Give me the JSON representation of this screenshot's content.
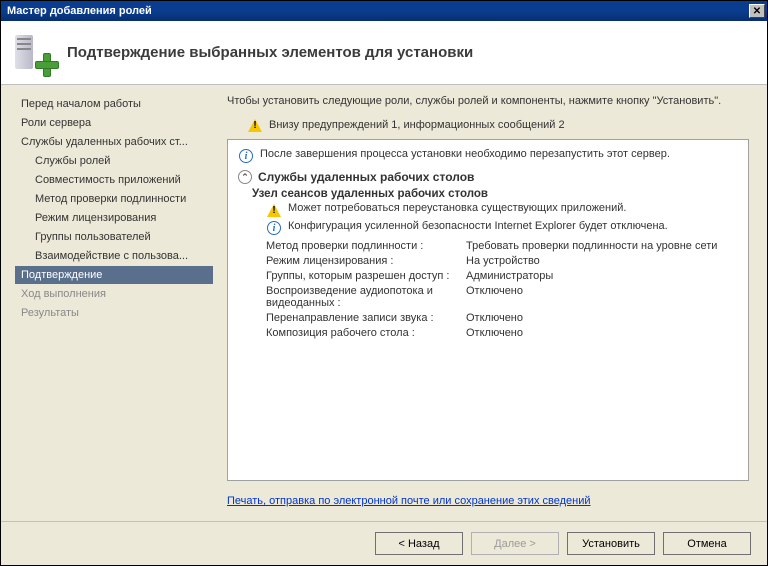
{
  "window": {
    "title": "Мастер добавления ролей"
  },
  "header": {
    "title": "Подтверждение выбранных элементов для установки"
  },
  "sidebar": {
    "items": [
      {
        "label": "Перед началом работы",
        "level": 0
      },
      {
        "label": "Роли сервера",
        "level": 0
      },
      {
        "label": "Службы удаленных рабочих ст...",
        "level": 0
      },
      {
        "label": "Службы ролей",
        "level": 1
      },
      {
        "label": "Совместимость приложений",
        "level": 1
      },
      {
        "label": "Метод проверки подлинности",
        "level": 1
      },
      {
        "label": "Режим лицензирования",
        "level": 1
      },
      {
        "label": "Группы пользователей",
        "level": 1
      },
      {
        "label": "Взаимодействие с пользова...",
        "level": 1
      },
      {
        "label": "Подтверждение",
        "level": 0,
        "selected": true
      },
      {
        "label": "Ход выполнения",
        "level": 0,
        "disabled": true
      },
      {
        "label": "Результаты",
        "level": 0,
        "disabled": true
      }
    ]
  },
  "main": {
    "intro": "Чтобы установить следующие роли, службы ролей и компоненты, нажмите кнопку \"Установить\".",
    "summary": "Внизу предупреждений 1, информационных сообщений 2",
    "restart_info": "После завершения процесса установки необходимо перезапустить этот сервер.",
    "role_name": "Службы удаленных рабочих столов",
    "subrole_name": "Узел сеансов удаленных рабочих столов",
    "warnings": [
      "Может потребоваться переустановка существующих приложений.",
      "Конфигурация усиленной безопасности Internet Explorer будет отключена."
    ],
    "kv": [
      {
        "k": "Метод проверки подлинности :",
        "v": "Требовать проверки подлинности на уровне сети"
      },
      {
        "k": "Режим лицензирования :",
        "v": "На устройство"
      },
      {
        "k": "Группы, которым разрешен доступ :",
        "v": "Администраторы"
      },
      {
        "k": "Воспроизведение аудиопотока и видеоданных :",
        "v": "Отключено"
      },
      {
        "k": "Перенаправление записи звука :",
        "v": "Отключено"
      },
      {
        "k": "Композиция рабочего стола :",
        "v": "Отключено"
      }
    ],
    "link": "Печать, отправка по электронной почте или сохранение этих сведений"
  },
  "buttons": {
    "back": "< Назад",
    "next": "Далее >",
    "install": "Установить",
    "cancel": "Отмена"
  }
}
